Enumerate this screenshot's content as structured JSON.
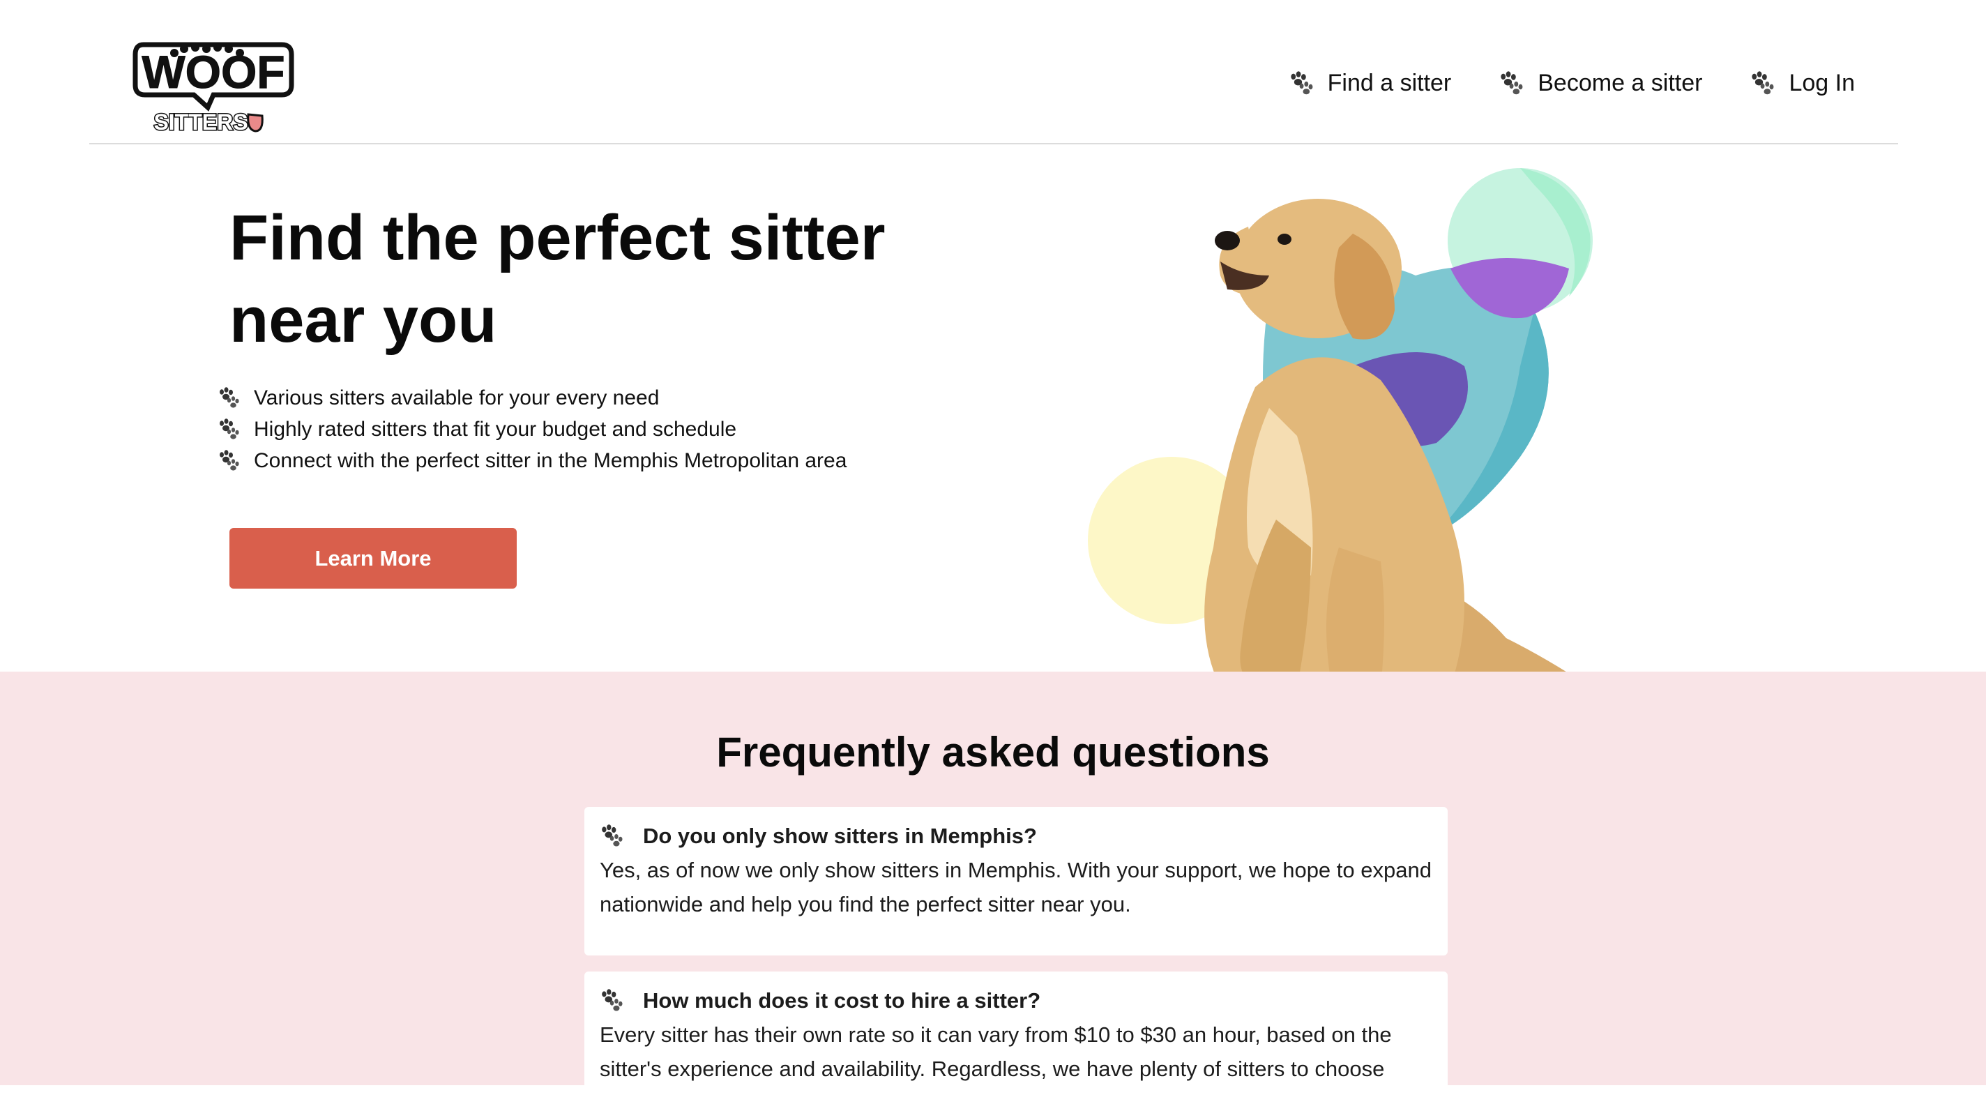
{
  "header": {
    "logo_text": "WOOF",
    "logo_subtext": "SITTERS",
    "nav": [
      {
        "label": "Find a sitter",
        "icon": "paw-icon"
      },
      {
        "label": "Become a sitter",
        "icon": "paw-icon"
      },
      {
        "label": "Log In",
        "icon": "paw-icon"
      }
    ]
  },
  "hero": {
    "title": "Find the perfect sitter near you",
    "features": [
      "Various sitters available for your every need",
      "Highly rated sitters that fit your budget and schedule",
      "Connect with the perfect sitter in the Memphis Metropolitan area"
    ],
    "cta_label": "Learn More"
  },
  "faq": {
    "title": "Frequently asked questions",
    "items": [
      {
        "question": "Do you only show sitters in Memphis?",
        "answer": "Yes, as of now we only show sitters in Memphis. With your support, we hope to expand nationwide and help you find the perfect sitter near you."
      },
      {
        "question": "How much does it cost to hire a sitter?",
        "answer": "Every sitter has their own rate so it can vary from $10 to $30 an hour, based on the sitter's experience and availability. Regardless, we have plenty of sitters to choose"
      }
    ]
  },
  "colors": {
    "accent": "#d95f4c",
    "faq_background": "#f9e4e7",
    "divider": "#dcdcdc",
    "blob_teal": "#7ec7d1",
    "blob_mint": "#c6f3e0",
    "blob_purple": "#a066d6",
    "blob_indigo": "#6a55b4",
    "blob_yellow": "#fdf7c7"
  }
}
